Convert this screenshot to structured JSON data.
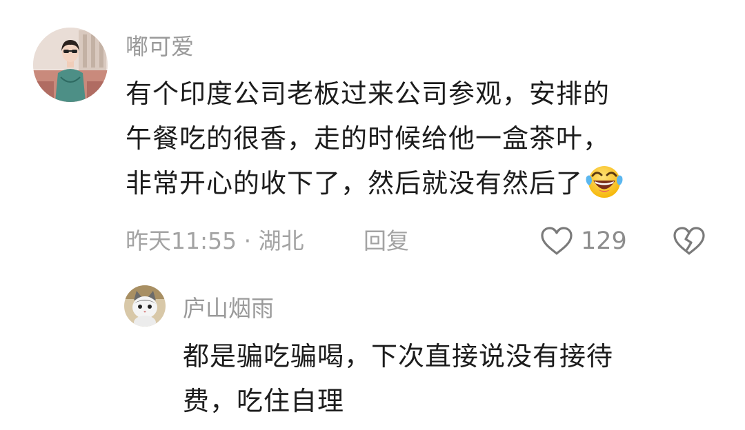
{
  "comment": {
    "username": "嘟可爱",
    "avatar_icon": "avatar-woman-qipao",
    "text_lines": [
      "有个印度公司老板过来公司参观，安排的",
      "午餐吃的很香，走的时候给他一盒茶叶，",
      "非常开心的收下了，然后就没有然后了"
    ],
    "emoji": "laughing-tears-emoji",
    "meta": "昨天11:55 · 湖北",
    "reply_label": "回复",
    "like_count": "129"
  },
  "reply": {
    "username": "庐山烟雨",
    "avatar_icon": "avatar-cat",
    "text_lines": [
      "都是骗吃骗喝，下次直接说没有接待",
      "费，吃住自理"
    ]
  },
  "colors": {
    "username": "#9a9a9a",
    "text": "#1c1c1c",
    "meta": "#a3a3a3",
    "icon_stroke": "#7a7a7a"
  }
}
